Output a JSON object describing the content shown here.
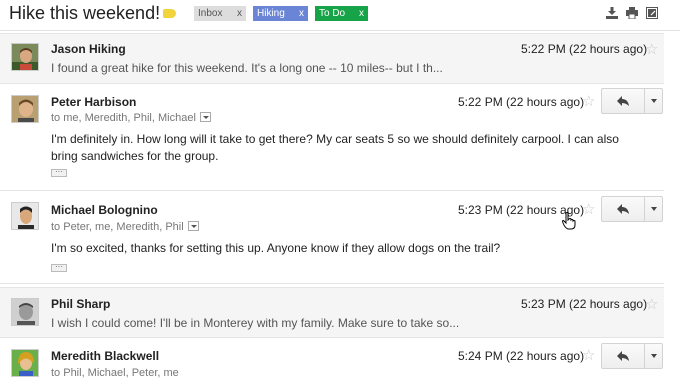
{
  "header": {
    "title": "Hike this weekend!",
    "labels": [
      {
        "text": "Inbox",
        "x": "x",
        "color": "#dddddd"
      },
      {
        "text": "Hiking",
        "x": "x",
        "color": "#6b85d6"
      },
      {
        "text": "To Do",
        "x": "x",
        "color": "#17a347"
      }
    ],
    "icons": [
      "expand-all-icon",
      "print-icon",
      "new-window-icon"
    ]
  },
  "messages": [
    {
      "sender": "Jason Hiking",
      "time": "5:22 PM (22 hours ago)",
      "snippet": "I found a great hike for this weekend. It's a long one -- 10 miles-- but I th..."
    },
    {
      "sender": "Peter Harbison",
      "time": "5:22 PM (22 hours ago)",
      "recipients": "to me, Meredith, Phil, Michael",
      "body": "I'm definitely in.  How long will it take to get there?  My car seats 5 so we should definitely carpool.  I can also bring sandwiches for the group."
    },
    {
      "sender": "Michael Bolognino",
      "time": "5:23 PM (22 hours ago)",
      "recipients": "to Peter, me, Meredith, Phil",
      "body": "I'm so excited, thanks for setting this up. Anyone know if they allow dogs on the trail?"
    },
    {
      "sender": "Phil Sharp",
      "time": "5:23 PM (22 hours ago)",
      "snippet": "I wish I could come! I'll be in Monterey with my family. Make sure to take so..."
    },
    {
      "sender": "Meredith Blackwell",
      "time": "5:24 PM (22 hours ago)",
      "recipients": "to Phil, Michael, Peter, me"
    }
  ],
  "colors": {
    "important": "#f1d43b",
    "collapsed_bg": "#f5f5f5",
    "divider": "#e5e5e5"
  }
}
